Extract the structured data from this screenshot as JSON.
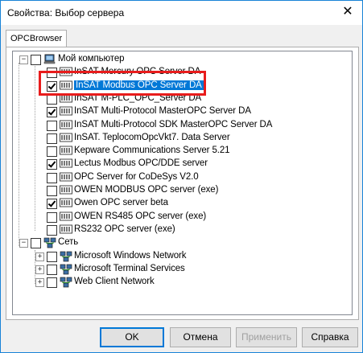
{
  "window": {
    "title": "Свойства: Выбор сервера",
    "close_glyph": "✕"
  },
  "tabs": [
    {
      "label": "OPCBrowser"
    }
  ],
  "tree": {
    "root_computer": {
      "label": "Мой компьютер",
      "icon": "computer-icon",
      "expanded": true
    },
    "servers": [
      {
        "label": "InSAT Mercury OPC Server DA",
        "checked": false
      },
      {
        "label": "InSAT Modbus OPC Server DA",
        "checked": true,
        "selected": true
      },
      {
        "label": "InSAT M-PLC_OPC_Server DA",
        "checked": false
      },
      {
        "label": "InSAT Multi-Protocol MasterOPC Server DA",
        "checked": true
      },
      {
        "label": "InSAT Multi-Protocol SDK MasterOPC Server DA",
        "checked": false
      },
      {
        "label": "InSAT.  TeplocomOpcVkt7. Data Server",
        "checked": false
      },
      {
        "label": "Kepware Communications Server 5.21",
        "checked": false
      },
      {
        "label": "Lectus Modbus OPC/DDE server",
        "checked": true
      },
      {
        "label": "OPC Server for CoDeSys V2.0",
        "checked": false
      },
      {
        "label": "OWEN MODBUS OPC server (exe)",
        "checked": false
      },
      {
        "label": "Owen OPC server beta",
        "checked": true
      },
      {
        "label": "OWEN RS485 OPC server (exe)",
        "checked": false
      },
      {
        "label": "RS232 OPC server (exe)",
        "checked": false
      }
    ],
    "root_network": {
      "label": "Сеть",
      "icon": "network-icon",
      "expanded": true
    },
    "networks": [
      {
        "label": "Microsoft Windows Network"
      },
      {
        "label": "Microsoft Terminal Services"
      },
      {
        "label": "Web Client Network"
      }
    ]
  },
  "buttons": {
    "ok": "OK",
    "cancel": "Отмена",
    "apply": "Применить",
    "help": "Справка"
  },
  "colors": {
    "highlight": "#0078d7",
    "annotation_box": "#e81c1c"
  }
}
